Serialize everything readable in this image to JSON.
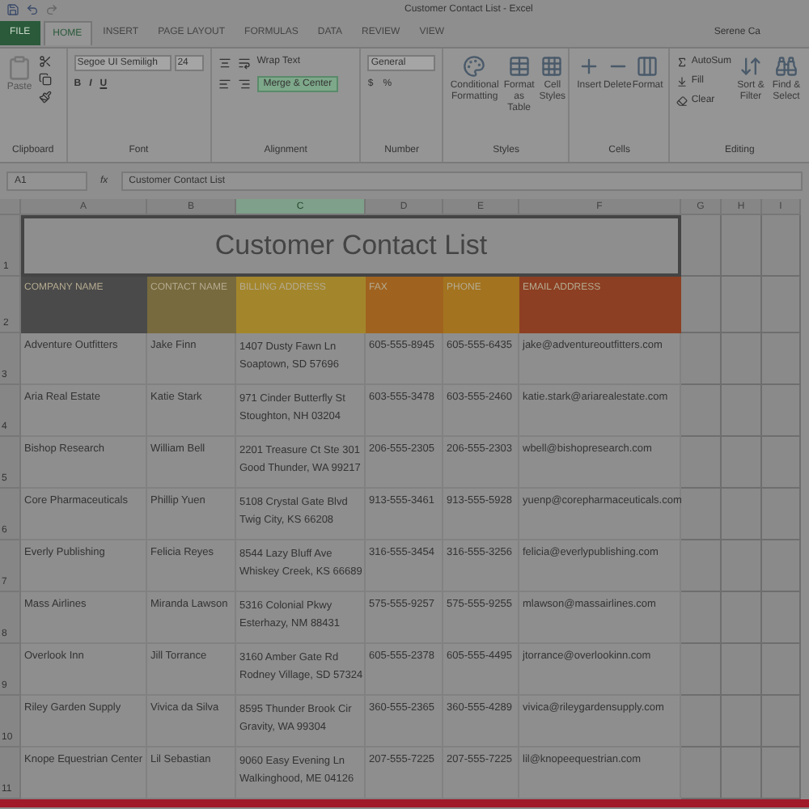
{
  "window": {
    "title": "Customer Contact List - Excel",
    "user": "Serene Ca"
  },
  "tabs": [
    {
      "label": "FILE",
      "selected": false,
      "kind": "file"
    },
    {
      "label": "HOME",
      "selected": true,
      "kind": "tab"
    },
    {
      "label": "INSERT",
      "selected": false,
      "kind": "tab"
    },
    {
      "label": "PAGE LAYOUT",
      "selected": false,
      "kind": "tab"
    },
    {
      "label": "FORMULAS",
      "selected": false,
      "kind": "tab"
    },
    {
      "label": "DATA",
      "selected": false,
      "kind": "tab"
    },
    {
      "label": "REVIEW",
      "selected": false,
      "kind": "tab"
    },
    {
      "label": "VIEW",
      "selected": false,
      "kind": "tab"
    }
  ],
  "ribbon": {
    "clipboard": {
      "label": "Clipboard",
      "paste": "Paste"
    },
    "font": {
      "label": "Font",
      "name": "Segoe UI Semiligh",
      "size": "24",
      "bold": "B",
      "italic": "I",
      "underline": "U"
    },
    "alignment": {
      "label": "Alignment",
      "wrap_text": "Wrap Text",
      "merge": "Merge & Center",
      "merge_selected": true
    },
    "number": {
      "label": "Number",
      "format": "General",
      "currency": "$",
      "percent": "%"
    },
    "styles": {
      "label": "Styles",
      "buttons": [
        "Conditional Formatting",
        "Format as Table",
        "Cell Styles"
      ]
    },
    "cells": {
      "label": "Cells",
      "buttons": [
        "Insert",
        "Delete",
        "Format"
      ]
    },
    "editing": {
      "label": "Editing",
      "small": [
        "AutoSum",
        "Fill",
        "Clear"
      ],
      "buttons": [
        "Sort & Filter",
        "Find & Select"
      ]
    }
  },
  "formula_bar": {
    "name_box": "A1",
    "fx": "fx",
    "formula": "Customer Contact List"
  },
  "sheet": {
    "columns": [
      {
        "label": "A",
        "selected": false
      },
      {
        "label": "B",
        "selected": false
      },
      {
        "label": "C",
        "selected": true
      },
      {
        "label": "D",
        "selected": false
      },
      {
        "label": "E",
        "selected": false
      },
      {
        "label": "F",
        "selected": false
      },
      {
        "label": "G",
        "selected": false
      },
      {
        "label": "H",
        "selected": false
      },
      {
        "label": "I",
        "selected": false
      }
    ],
    "title_row": "1",
    "title": "Customer Contact List",
    "header_row": "2",
    "headers": [
      {
        "text": "COMPANY NAME",
        "color": "#4a4a4a"
      },
      {
        "text": "CONTACT NAME",
        "color": "#776a3e"
      },
      {
        "text": "BILLING ADDRESS",
        "color": "#a3862c"
      },
      {
        "text": "FAX",
        "color": "#a0631f"
      },
      {
        "text": "PHONE",
        "color": "#a3731f"
      },
      {
        "text": "EMAIL ADDRESS",
        "color": "#8c3f22"
      }
    ],
    "rows": [
      {
        "number": "3",
        "company": "Adventure Outfitters",
        "contact": "Jake Finn",
        "address": [
          "1407 Dusty Fawn Ln",
          "Soaptown, SD 57696"
        ],
        "fax": "605-555-8945",
        "phone": "605-555-6435",
        "email": "jake@adventureoutfitters.com"
      },
      {
        "number": "4",
        "company": "Aria Real Estate",
        "contact": "Katie Stark",
        "address": [
          "971 Cinder Butterfly St",
          "Stoughton, NH 03204"
        ],
        "fax": "603-555-3478",
        "phone": "603-555-2460",
        "email": "katie.stark@ariarealestate.com"
      },
      {
        "number": "5",
        "company": "Bishop Research",
        "contact": "William Bell",
        "address": [
          "2201 Treasure Ct Ste 301",
          "Good Thunder, WA 99217"
        ],
        "fax": "206-555-2305",
        "phone": "206-555-2303",
        "email": "wbell@bishopresearch.com"
      },
      {
        "number": "6",
        "company": "Core Pharmaceuticals",
        "contact": "Phillip Yuen",
        "address": [
          "5108 Crystal Gate Blvd",
          "Twig City, KS 66208"
        ],
        "fax": "913-555-3461",
        "phone": "913-555-5928",
        "email": "yuenp@corepharmaceuticals.com"
      },
      {
        "number": "7",
        "company": "Everly Publishing",
        "contact": "Felicia Reyes",
        "address": [
          "8544 Lazy Bluff Ave",
          "Whiskey Creek, KS 66689"
        ],
        "fax": "316-555-3454",
        "phone": "316-555-3256",
        "email": "felicia@everlypublishing.com"
      },
      {
        "number": "8",
        "company": "Mass Airlines",
        "contact": "Miranda Lawson",
        "address": [
          "5316 Colonial Pkwy",
          "Esterhazy, NM 88431"
        ],
        "fax": "575-555-9257",
        "phone": "575-555-9255",
        "email": "mlawson@massairlines.com"
      },
      {
        "number": "9",
        "company": "Overlook Inn",
        "contact": "Jill Torrance",
        "address": [
          "3160 Amber Gate Rd",
          "Rodney Village, SD 57324"
        ],
        "fax": "605-555-2378",
        "phone": "605-555-4495",
        "email": "jtorrance@overlookinn.com"
      },
      {
        "number": "10",
        "company": "Riley Garden Supply",
        "contact": "Vivica da Silva",
        "address": [
          "8595 Thunder Brook Cir",
          "Gravity, WA 99304"
        ],
        "fax": "360-555-2365",
        "phone": "360-555-4289",
        "email": "vivica@rileygardensupply.com"
      },
      {
        "number": "11",
        "company": "Knope Equestrian Center",
        "contact": "Lil Sebastian",
        "address": [
          "9060 Easy Evening Ln",
          "Walkinghood, ME 04126"
        ],
        "fax": "207-555-7225",
        "phone": "207-555-7225",
        "email": "lil@knopeequestrian.com"
      }
    ]
  }
}
